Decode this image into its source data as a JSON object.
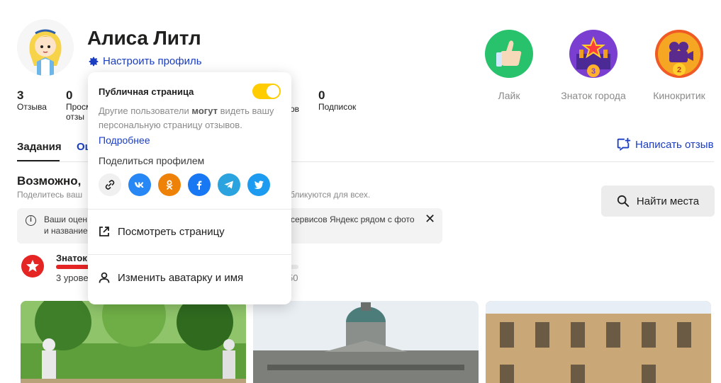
{
  "profile": {
    "name": "Алиса Литл",
    "settings_label": "Настроить профиль"
  },
  "stats": [
    {
      "value": "3",
      "label": "Отзыва"
    },
    {
      "value": "0",
      "label_line1": "Просм",
      "label_line2": "отзы"
    },
    {
      "label_tail": "ов"
    },
    {
      "value": "0",
      "label": "Подписок"
    }
  ],
  "badges": [
    {
      "label": "Лайк",
      "icon": "thumbs-up-icon"
    },
    {
      "label": "Знаток города",
      "icon": "city-expert-icon",
      "level": "3"
    },
    {
      "label": "Кинокритик",
      "icon": "film-critic-icon",
      "level": "2"
    }
  ],
  "tabs": [
    {
      "label": "Задания"
    },
    {
      "label": "Оц"
    }
  ],
  "write_review_label": "Написать отзыв",
  "section": {
    "title": "Возможно, ",
    "subtitle_left": "Поделитесь ваш",
    "subtitle_right": "бликуются для всех."
  },
  "find_places_label": "Найти места",
  "info_box": {
    "line1_left": "Ваши оцен",
    "line1_right": "сервисов Яндекс рядом с фото",
    "line2_left": "и название"
  },
  "level": {
    "name": "Знаток",
    "text": "3 урове",
    "count": "50",
    "progress": 0.2
  },
  "popup": {
    "title": "Публичная страница",
    "toggle_on": true,
    "desc_before": "Другие пользователи ",
    "desc_bold": "могут",
    "desc_after": " видеть вашу персональную страницу отзывов.",
    "more_label": "Подробнее",
    "share_label": "Поделиться профилем",
    "shares": [
      {
        "icon": "link-icon",
        "color": "#f0f0f0"
      },
      {
        "icon": "vk-icon",
        "color": "#2787f5"
      },
      {
        "icon": "ok-icon",
        "color": "#ee8208"
      },
      {
        "icon": "facebook-icon",
        "color": "#1877f2"
      },
      {
        "icon": "telegram-icon",
        "color": "#2aa3df"
      },
      {
        "icon": "twitter-icon",
        "color": "#1d9bf0"
      }
    ],
    "view_page_label": "Посмотреть страницу",
    "edit_avatar_label": "Изменить аватарку и имя"
  },
  "colors": {
    "accent": "#1a3dc2",
    "toggle": "#ffcc00",
    "red": "#e52424"
  }
}
